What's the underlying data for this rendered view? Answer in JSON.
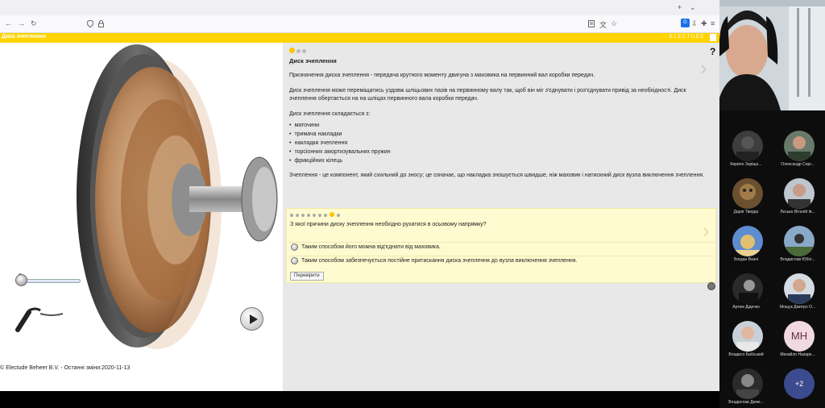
{
  "browser": {
    "tab_controls": {
      "new_tab": "+",
      "list_all_tabs": "⌄"
    },
    "nav": {
      "back": "←",
      "forward": "→",
      "reload": "↻"
    },
    "icons": [
      "shield-icon",
      "lock-icon",
      "reader-icon",
      "translate-icon",
      "star-icon",
      "extension-icon",
      "download-icon",
      "puzzle-icon",
      "menu-icon"
    ],
    "extension_badge": "G"
  },
  "page": {
    "header_title": "Диск зчеплення",
    "brand": "ELECTUDE",
    "slider": {
      "value": "0",
      "level": 0
    },
    "copyright": "© Electude Beheer B.V. - Останні зміни:2020-11-13",
    "content": {
      "help": "?",
      "title": "Диск зчеплення",
      "intro": "Призначення диска зчеплення - передача крутного моменту двигуна з маховика на первинний вал коробки передач.",
      "para2": "Диск зчеплення може переміщатись уздовж шліцьових пазів на первинному валу так, щоб він міг з'єднувати і роз'єднувати привід за необхідності. Диск зчеплення обертається на на шліцах первинного вала коробки передач.",
      "list_intro": "Диск зчеплення складається з:",
      "parts": [
        "маточини",
        "тримача накладки",
        "накладки зчеплення",
        "торсіонних амортизувальних пружин",
        "фрикційних кілець"
      ],
      "para3": "Зчеплення - це компонент, який схильний до зносу; це означає, що накладка зношується швидше, ніж маховик і натискний диск вузла виключення зчеплення."
    },
    "quiz": {
      "question": "З якої причини диску зчеплення необхідно рухатися в осьовому напрямку?",
      "answers": [
        "Таким способом його можна від'єднати від маховика.",
        "Таким способом забезпечується постійне притискання диска зчеплення до вузла виключення зчеплення."
      ],
      "check_label": "Перевірити"
    }
  },
  "call": {
    "participants": [
      {
        "name": "Кирило Заріщн...",
        "initials": ""
      },
      {
        "name": "Олександр Серг...",
        "initials": ""
      },
      {
        "name": "Дарія Твердо",
        "initials": ""
      },
      {
        "name": "Лесько Віталій Ів...",
        "initials": ""
      },
      {
        "name": "Богдан Вазні",
        "initials": ""
      },
      {
        "name": "Владислав Юбіл...",
        "initials": ""
      },
      {
        "name": "Артем Дідечко",
        "initials": ""
      },
      {
        "name": "Мощук Дмитро О...",
        "initials": ""
      },
      {
        "name": "Владисл Бабський",
        "initials": ""
      },
      {
        "name": "Михайло Назаре...",
        "initials": "МН"
      },
      {
        "name": "Владислав Деме...",
        "initials": ""
      }
    ],
    "more_count": "+2"
  }
}
